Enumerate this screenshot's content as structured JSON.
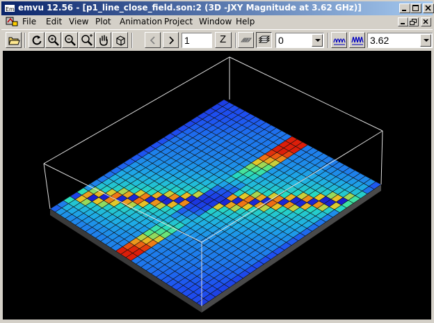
{
  "window": {
    "title": "emvu 12.56 - [p1_line_close_field.son:2 (3D -JXY Magnitude at 3.62 GHz)]"
  },
  "menu": {
    "items": [
      "File",
      "Edit",
      "View",
      "Plot",
      "Animation",
      "Project",
      "Window",
      "Help"
    ]
  },
  "toolbar": {
    "frame_value": "1",
    "z_label": "Z",
    "level_value": "0",
    "frequency_value": "3.62"
  },
  "colors": {
    "title_start": "#0a246a",
    "title_end": "#a6caf0",
    "canvas_bg": "#000000",
    "field_low": "#1b1be0",
    "field_mid": "#2ad0c8",
    "field_high": "#e83010"
  }
}
